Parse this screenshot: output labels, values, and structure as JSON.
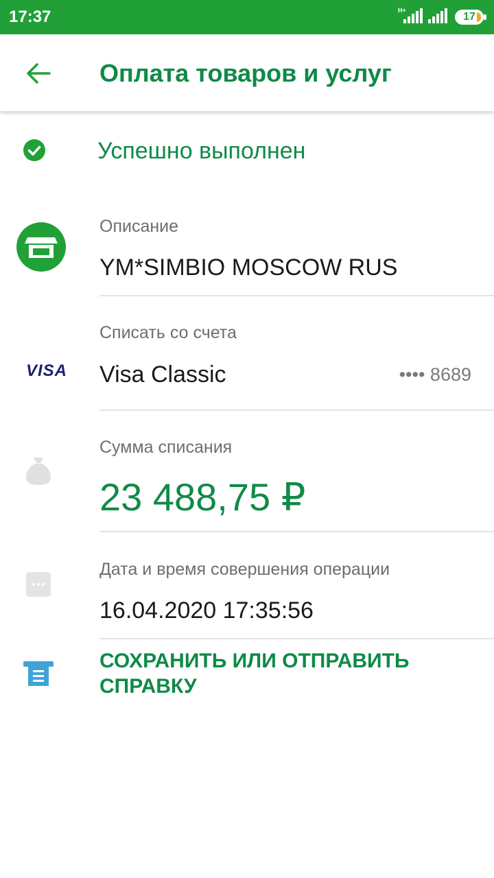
{
  "status_bar": {
    "time": "17:37",
    "network": "H+",
    "battery": "17"
  },
  "header": {
    "title": "Оплата товаров и услуг"
  },
  "operation_status": "Успешно выполнен",
  "details": {
    "description": {
      "label": "Описание",
      "value": "YM*SIMBIO MOSCOW RUS"
    },
    "account": {
      "label": "Списать со счета",
      "card_brand": "VISA",
      "value": "Visa Classic",
      "card_mask": "•••• 8689"
    },
    "amount": {
      "label": "Сумма списания",
      "value": "23 488,75 ₽"
    },
    "datetime": {
      "label": "Дата и время совершения операции",
      "value": "16.04.2020 17:35:56"
    }
  },
  "action": {
    "label": "СОХРАНИТЬ ИЛИ ОТПРАВИТЬ СПРАВКУ"
  },
  "colors": {
    "brand_green": "#21a038",
    "text_green": "#0f8a47",
    "receipt_blue": "#3fa3d6"
  }
}
